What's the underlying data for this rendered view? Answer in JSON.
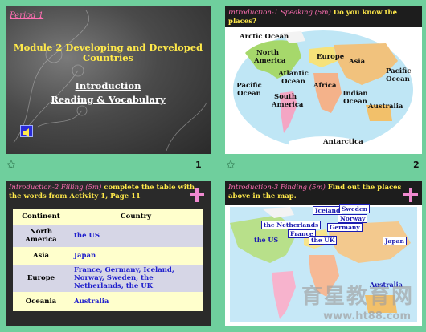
{
  "slide1": {
    "period": "Period 1",
    "title_line1": "Module 2 Developing and Developed",
    "title_line2": "Countries",
    "link1": "Introduction",
    "link2": "Reading & Vocabulary",
    "number": "1"
  },
  "slide2": {
    "header_italic": "Introduction-1 Speaking (5m)",
    "header_bold": " Do you know the places?",
    "labels": {
      "arctic": "Arctic Ocean",
      "north_america": "North America",
      "europe": "Europe",
      "asia": "Asia",
      "pacific_right": "Pacific Ocean",
      "atlantic": "Atlantic Ocean",
      "pacific_left": "Pacific Ocean",
      "africa": "Africa",
      "indian": "Indian Ocean",
      "south_america": "South America",
      "australia": "Australia",
      "antarctica": "Antarctica"
    },
    "number": "2"
  },
  "slide3": {
    "header_italic": "Introduction-2 Filling (5m)",
    "header_bold": " complete the table with the words from Activity 1, Page 11",
    "table": {
      "headers": [
        "Continent",
        "Country"
      ],
      "rows": [
        [
          "North America",
          "the US"
        ],
        [
          "Asia",
          "Japan"
        ],
        [
          "Europe",
          "France, Germany, Iceland, Norway, Sweden, the Netherlands, the UK"
        ],
        [
          "Oceania",
          "Australia"
        ]
      ]
    }
  },
  "slide4": {
    "header_italic": "Introduction-3 Finding (5m)",
    "header_bold": " Find out the places above in the map.",
    "labels": {
      "iceland": "Iceland",
      "sweden": "Sweden",
      "norway": "Norway",
      "netherlands": "the Netherlands",
      "germany": "Germany",
      "france": "France",
      "the_us": "the US",
      "the_uk": "the UK",
      "japan": "Japan",
      "australia": "Australia"
    },
    "watermark": "育星教育网",
    "watermark_url": "www.ht88.com"
  }
}
